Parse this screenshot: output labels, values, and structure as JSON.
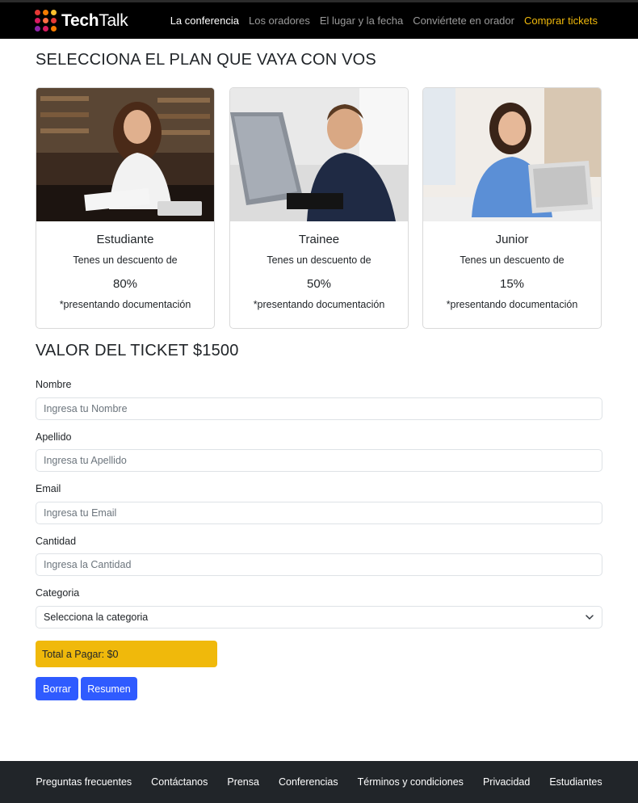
{
  "brand": {
    "name_bold": "Tech",
    "name_light": "Talk"
  },
  "nav": {
    "items": [
      {
        "label": "La conferencia",
        "state": "active"
      },
      {
        "label": "Los oradores",
        "state": "normal"
      },
      {
        "label": "El lugar y la fecha",
        "state": "normal"
      },
      {
        "label": "Conviértete en orador",
        "state": "normal"
      },
      {
        "label": "Comprar tickets",
        "state": "highlight"
      }
    ]
  },
  "plans": {
    "title": "SELECCIONA EL PLAN QUE VAYA CON VOS",
    "cards": [
      {
        "name": "Estudiante",
        "desc": "Tenes un descuento de",
        "discount": "80%",
        "note": "*presentando documentación",
        "image": "student-photo"
      },
      {
        "name": "Trainee",
        "desc": "Tenes un descuento de",
        "discount": "50%",
        "note": "*presentando documentación",
        "image": "trainee-photo"
      },
      {
        "name": "Junior",
        "desc": "Tenes un descuento de",
        "discount": "15%",
        "note": "*presentando documentación",
        "image": "junior-photo"
      }
    ]
  },
  "ticket": {
    "title": "VALOR DEL TICKET $1500",
    "fields": {
      "nombre": {
        "label": "Nombre",
        "placeholder": "Ingresa tu Nombre"
      },
      "apellido": {
        "label": "Apellido",
        "placeholder": "Ingresa tu Apellido"
      },
      "email": {
        "label": "Email",
        "placeholder": "Ingresa tu Email"
      },
      "cantidad": {
        "label": "Cantidad",
        "placeholder": "Ingresa la Cantidad"
      },
      "categoria": {
        "label": "Categoria",
        "selected": "Selecciona la categoria"
      }
    },
    "total": "Total a Pagar: $0",
    "buttons": {
      "clear": "Borrar",
      "summary": "Resumen"
    }
  },
  "footer": {
    "links": [
      "Preguntas frecuentes",
      "Contáctanos",
      "Prensa",
      "Conferencias",
      "Términos y condiciones",
      "Privacidad",
      "Estudiantes"
    ]
  },
  "colors": {
    "accent_yellow": "#f0b90b",
    "button_blue": "#2f5bff",
    "footer_bg": "#212529",
    "nav_bg": "#000000"
  },
  "icons": {
    "select": "chevron-down-icon",
    "brand": "techtalk-logo-icon"
  }
}
